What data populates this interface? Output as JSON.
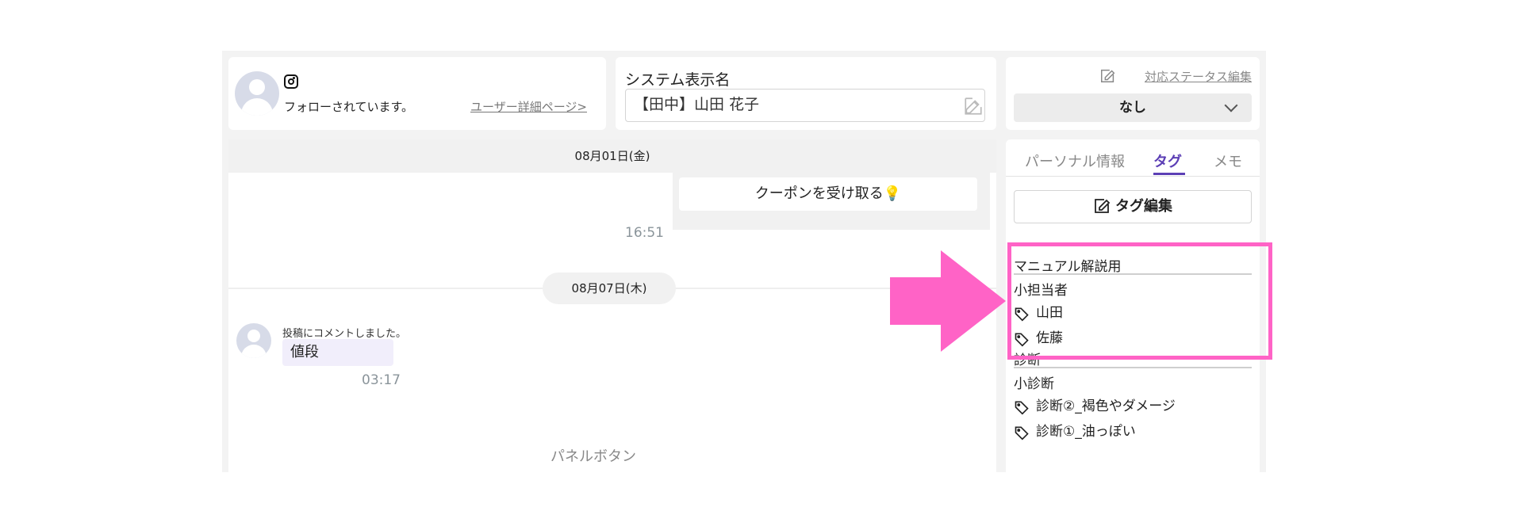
{
  "user_card": {
    "follow_text": "フォローされています。",
    "detail_link": "ユーザー詳細ページ>"
  },
  "display_name": {
    "label": "システム表示名",
    "value": "【田中】山田 花子"
  },
  "status": {
    "edit_label": "対応ステータス編集",
    "selected": "なし"
  },
  "chat": {
    "date1": "08月01日(金)",
    "coupon_message": "クーポンを受け取る💡",
    "time1": "16:51",
    "date2": "08月07日(木)",
    "comment_label": "投稿にコメントしました。",
    "comment_text": "値段",
    "time2": "03:17",
    "panel_button": "パネルボタン"
  },
  "side": {
    "tabs": [
      {
        "label": "パーソナル情報",
        "active": false
      },
      {
        "label": "タグ",
        "active": true
      },
      {
        "label": "メモ",
        "active": false
      }
    ],
    "tag_edit_label": "タグ編集",
    "groups": [
      {
        "title": "マニュアル解説用",
        "subgroup": "小担当者",
        "tags": [
          "山田",
          "佐藤"
        ]
      },
      {
        "title": "診断",
        "subgroup": "小診断",
        "tags": [
          "診断②_褐色やダメージ",
          "診断①_油っぽい"
        ]
      }
    ]
  },
  "colors": {
    "accent": "#5c3fb5",
    "highlight": "#ff63c6",
    "comment_bubble": "#f1eefb"
  }
}
